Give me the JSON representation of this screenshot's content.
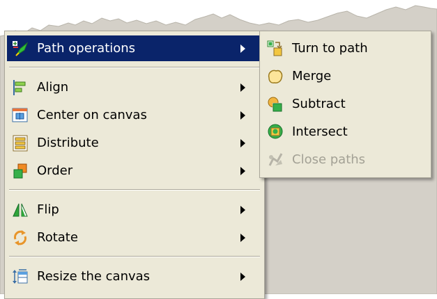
{
  "context_menu": {
    "items": [
      {
        "label": "Path operations",
        "icon": "path-operations-icon",
        "has_submenu": true,
        "selected": true
      },
      {
        "label": "Align",
        "icon": "align-icon",
        "has_submenu": true
      },
      {
        "label": "Center on canvas",
        "icon": "center-on-canvas-icon",
        "has_submenu": true
      },
      {
        "label": "Distribute",
        "icon": "distribute-icon",
        "has_submenu": true
      },
      {
        "label": "Order",
        "icon": "order-icon",
        "has_submenu": true
      },
      {
        "label": "Flip",
        "icon": "flip-icon",
        "has_submenu": true
      },
      {
        "label": "Rotate",
        "icon": "rotate-icon",
        "has_submenu": true
      },
      {
        "label": "Resize the canvas",
        "icon": "resize-canvas-icon",
        "has_submenu": true
      }
    ]
  },
  "submenu": {
    "items": [
      {
        "label": "Turn to path",
        "icon": "turn-to-path-icon",
        "enabled": true
      },
      {
        "label": "Merge",
        "icon": "merge-icon",
        "enabled": true
      },
      {
        "label": "Subtract",
        "icon": "subtract-icon",
        "enabled": true
      },
      {
        "label": "Intersect",
        "icon": "intersect-icon",
        "enabled": true
      },
      {
        "label": "Close paths",
        "icon": "close-paths-icon",
        "enabled": false
      }
    ]
  },
  "colors": {
    "menu_bg": "#ece9d8",
    "selection_bg": "#0a246a",
    "disabled_text": "#a3a195"
  }
}
